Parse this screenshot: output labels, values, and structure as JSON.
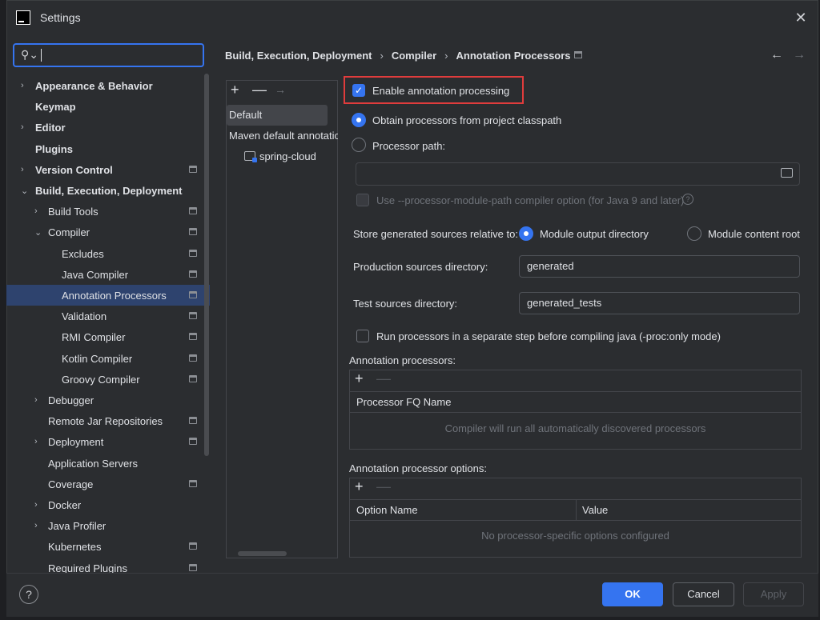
{
  "window": {
    "title": "Settings",
    "close_glyph": "✕"
  },
  "search": {
    "value": "",
    "icon": "search-icon"
  },
  "tree": [
    {
      "label": "Appearance & Behavior",
      "bold": true,
      "arrow": "›"
    },
    {
      "label": "Keymap",
      "bold": true,
      "arrow": ""
    },
    {
      "label": "Editor",
      "bold": true,
      "arrow": "›"
    },
    {
      "label": "Plugins",
      "bold": true,
      "arrow": ""
    },
    {
      "label": "Version Control",
      "bold": true,
      "arrow": "›",
      "pin": true
    },
    {
      "label": "Build, Execution, Deployment",
      "bold": true,
      "arrow": "⌄"
    },
    {
      "label": "Build Tools",
      "arrow": "›",
      "pin": true
    },
    {
      "label": "Compiler",
      "arrow": "⌄",
      "pin": true
    },
    {
      "label": "Excludes",
      "pin": true
    },
    {
      "label": "Java Compiler",
      "pin": true
    },
    {
      "label": "Annotation Processors",
      "pin": true,
      "selected": true
    },
    {
      "label": "Validation",
      "pin": true
    },
    {
      "label": "RMI Compiler",
      "pin": true
    },
    {
      "label": "Kotlin Compiler",
      "pin": true
    },
    {
      "label": "Groovy Compiler",
      "pin": true
    },
    {
      "label": "Debugger",
      "arrow": "›"
    },
    {
      "label": "Remote Jar Repositories",
      "pin": true
    },
    {
      "label": "Deployment",
      "arrow": "›",
      "pin": true
    },
    {
      "label": "Application Servers"
    },
    {
      "label": "Coverage",
      "pin": true
    },
    {
      "label": "Docker",
      "arrow": "›"
    },
    {
      "label": "Java Profiler",
      "arrow": "›"
    },
    {
      "label": "Kubernetes",
      "pin": true
    },
    {
      "label": "Required Plugins",
      "pin": true
    }
  ],
  "breadcrumb": {
    "items": [
      "Build, Execution, Deployment",
      "Compiler",
      "Annotation Processors"
    ],
    "separator": "›",
    "back": "←",
    "forward": "→"
  },
  "profiles": {
    "add": "+",
    "remove": "—",
    "move": "→",
    "default": "Default",
    "maven": "Maven default annotation processors profile",
    "module": "spring-cloud"
  },
  "options": {
    "enable_processing": "Enable annotation processing",
    "check_mark": "✓",
    "obtain_classpath": "Obtain processors from project classpath",
    "processor_path": "Processor path:",
    "processor_path_value": "",
    "module_path_option": "Use --processor-module-path compiler option (for Java 9 and later)",
    "help_glyph": "?",
    "store_relative": "Store generated sources relative to:",
    "module_output": "Module output directory",
    "module_content": "Module content root",
    "production_dir_label": "Production sources directory:",
    "production_dir_value": "generated",
    "test_dir_label": "Test sources directory:",
    "test_dir_value": "generated_tests",
    "run_separate": "Run processors in a separate step before compiling java (-proc:only mode)"
  },
  "processors_table": {
    "title": "Annotation processors:",
    "column": "Processor FQ Name",
    "empty": "Compiler will run all automatically discovered processors",
    "add": "+",
    "remove": "—"
  },
  "options_table": {
    "title": "Annotation processor options:",
    "columns": [
      "Option Name",
      "Value"
    ],
    "empty": "No processor-specific options configured",
    "add": "+",
    "remove": "—"
  },
  "buttons": {
    "help": "?",
    "ok": "OK",
    "cancel": "Cancel",
    "apply": "Apply"
  },
  "colors": {
    "accent": "#3574f0",
    "highlight_box": "#e03c3c",
    "selection": "#2e436e",
    "background": "#2b2d30"
  }
}
